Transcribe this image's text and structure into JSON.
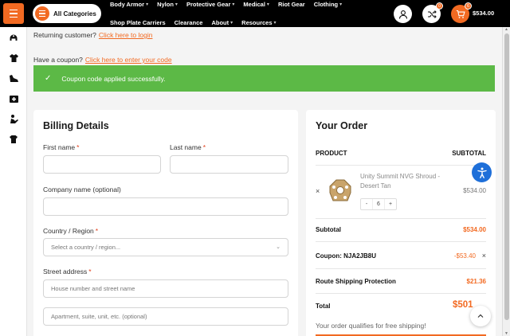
{
  "header": {
    "all_categories": "All Categories",
    "nav_row1": [
      "Body Armor",
      "Nylon",
      "Protective Gear",
      "Medical",
      "Riot Gear",
      "Clothing"
    ],
    "nav_row1_has_caret": [
      true,
      true,
      true,
      true,
      false,
      true
    ],
    "nav_row2": [
      "Shop Plate Carriers",
      "Clearance",
      "About",
      "Resources"
    ],
    "nav_row2_has_caret": [
      false,
      false,
      true,
      true
    ],
    "compare_badge": "0",
    "cart_badge": "6",
    "cart_total": "$534.00",
    "accent_color": "#f26a22"
  },
  "sidebar": {
    "icons": [
      "helmet-icon",
      "tshirt-icon",
      "boot-icon",
      "medkit-icon",
      "officer-icon",
      "shirt-icon"
    ]
  },
  "notices": {
    "returning_text": "Returning customer?",
    "returning_link": "Click here to login",
    "coupon_text": "Have a coupon?",
    "coupon_link": "Click here to enter your code",
    "success": "Coupon code applied successfully.",
    "success_color": "#5cb946"
  },
  "billing": {
    "title": "Billing Details",
    "first_name_label": "First name",
    "last_name_label": "Last name",
    "company_label": "Company name (optional)",
    "country_label": "Country / Region",
    "country_placeholder": "Select a country / region...",
    "street_label": "Street address",
    "street_placeholder": "House number and street name",
    "apt_placeholder": "Apartment, suite, unit, etc. (optional)",
    "required_mark": "*"
  },
  "order": {
    "title": "Your Order",
    "col_product": "PRODUCT",
    "col_subtotal": "SUBTOTAL",
    "remove_glyph": "×",
    "item": {
      "name": "Unity Summit NVG Shroud - Desert Tan",
      "quantity": "6",
      "minus": "-",
      "plus": "+",
      "line_total": "$534.00"
    },
    "subtotal_label": "Subtotal",
    "subtotal_value": "$534.00",
    "coupon_label": "Coupon: NJA2JB8U",
    "coupon_value": "-$53.40",
    "shipping_protection_label": "Route Shipping Protection",
    "shipping_protection_value": "$21.36",
    "total_label": "Total",
    "total_value": "$501",
    "free_shipping": "Your order qualifies for free shipping!"
  }
}
